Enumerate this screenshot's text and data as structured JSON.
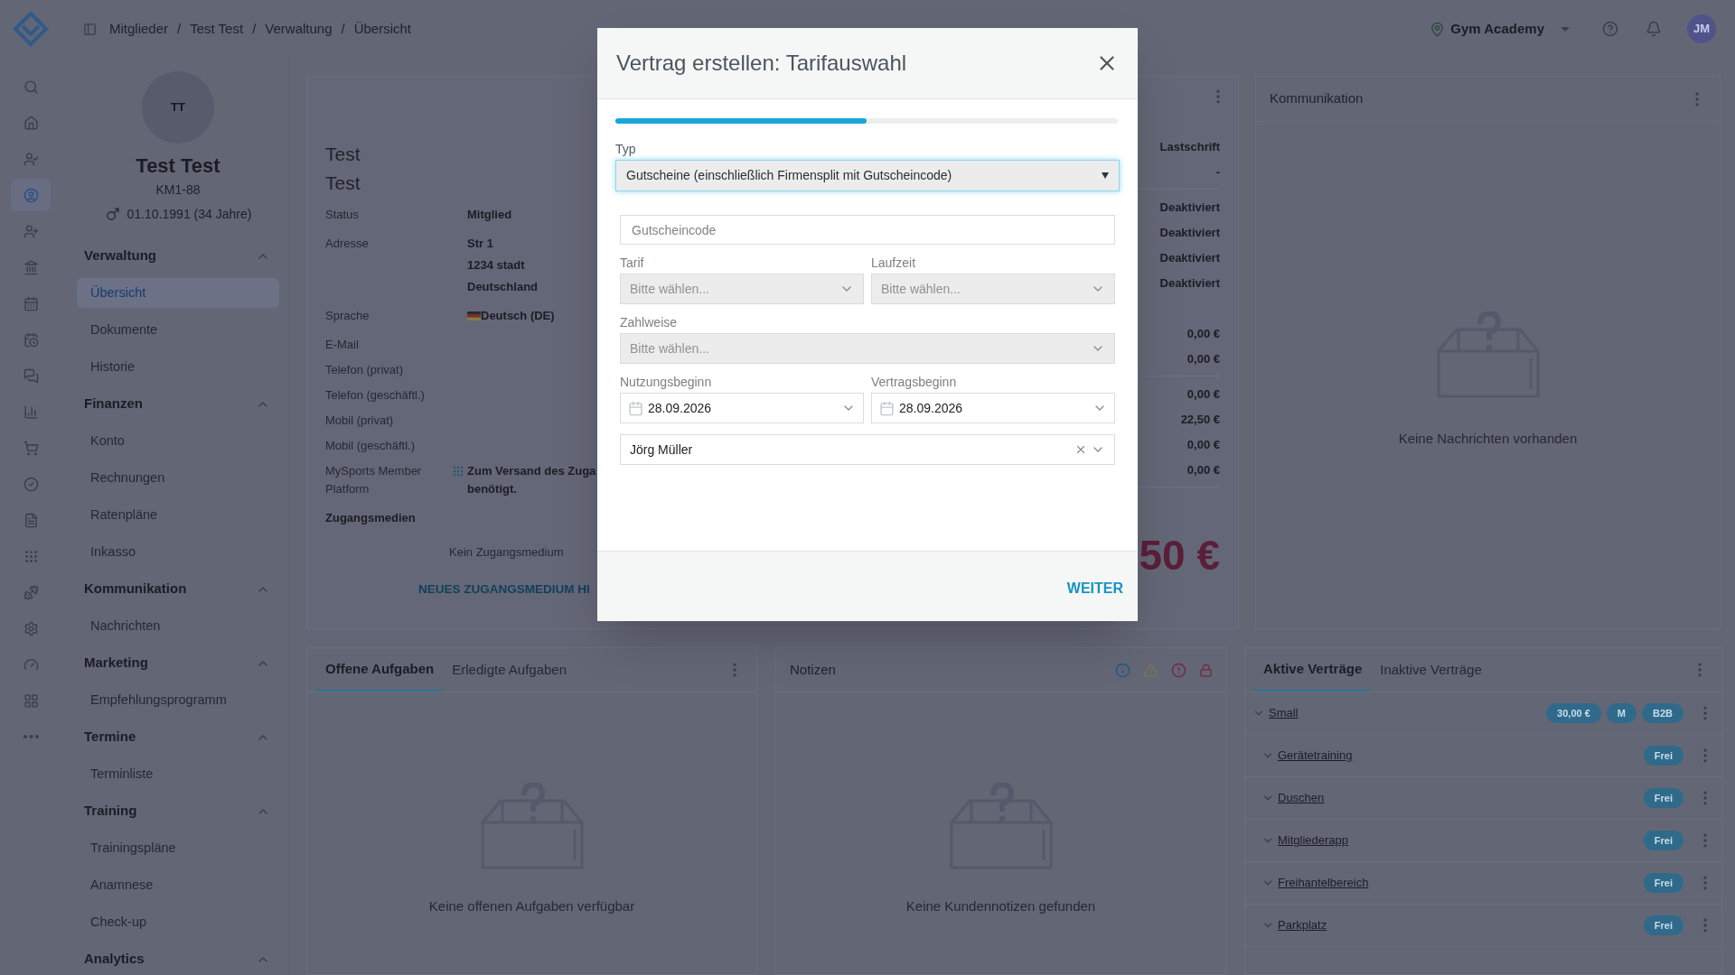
{
  "topbar": {
    "breadcrumb": [
      "Mitglieder",
      "Test Test",
      "Verwaltung",
      "Übersicht"
    ],
    "separator": "/",
    "location": "Gym Academy",
    "avatar": "JM"
  },
  "rail": [
    {
      "selected": false
    },
    {
      "selected": false
    },
    {
      "selected": false
    },
    {
      "selected": true
    },
    {
      "selected": false
    },
    {
      "selected": false
    },
    {
      "selected": false
    },
    {
      "selected": false
    },
    {
      "selected": false
    },
    {
      "selected": false
    },
    {
      "selected": false
    },
    {
      "selected": false
    },
    {
      "selected": false
    },
    {
      "selected": false
    },
    {
      "selected": false
    },
    {
      "selected": false
    },
    {
      "selected": false
    },
    {
      "selected": false
    }
  ],
  "profile": {
    "initials": "TT",
    "name": "Test Test",
    "number": "KM1-88",
    "birthdate": "01.10.1991 (34 Jahre)"
  },
  "nav": [
    {
      "title": "Verwaltung",
      "expanded": true,
      "items": [
        {
          "label": "Übersicht",
          "selected": true
        },
        {
          "label": "Dokumente",
          "selected": false
        },
        {
          "label": "Historie",
          "selected": false
        }
      ]
    },
    {
      "title": "Finanzen",
      "expanded": true,
      "items": [
        {
          "label": "Konto",
          "selected": false
        },
        {
          "label": "Rechnungen",
          "selected": false
        },
        {
          "label": "Ratenpläne",
          "selected": false
        },
        {
          "label": "Inkasso",
          "selected": false
        }
      ]
    },
    {
      "title": "Kommunikation",
      "expanded": true,
      "items": [
        {
          "label": "Nachrichten",
          "selected": false
        }
      ]
    },
    {
      "title": "Marketing",
      "expanded": true,
      "items": [
        {
          "label": "Empfehlungsprogramm",
          "selected": false
        }
      ]
    },
    {
      "title": "Termine",
      "expanded": true,
      "items": [
        {
          "label": "Terminliste",
          "selected": false
        }
      ]
    },
    {
      "title": "Training",
      "expanded": true,
      "items": [
        {
          "label": "Trainingspläne",
          "selected": false
        },
        {
          "label": "Anamnese",
          "selected": false
        },
        {
          "label": "Check-up",
          "selected": false
        }
      ]
    },
    {
      "title": "Analytics",
      "expanded": true
    }
  ],
  "member_card": {
    "names": [
      "Test",
      "Test"
    ],
    "fields": [
      {
        "label": "Status",
        "kind": "text",
        "values": [
          "Mitglied"
        ]
      },
      {
        "label": "Adresse",
        "kind": "text",
        "values": [
          "Str 1",
          "1234 stadt",
          "Deutschland"
        ]
      },
      {
        "label": "Sprache",
        "kind": "language",
        "values": [
          "Deutsch (DE)"
        ]
      },
      {
        "label": "E-Mail"
      },
      {
        "label": "Telefon (privat)"
      },
      {
        "label": "Telefon (geschäftl.)"
      },
      {
        "label": "Mobil (privat)"
      },
      {
        "label": "Mobil (geschäftl.)"
      },
      {
        "label": "MySports Member Platform",
        "kind": "platform",
        "values": [
          "Zum Versand des Zuga",
          "benötigt."
        ]
      }
    ],
    "access_title": "Zugangsmedien",
    "access_empty": "Kein Zugangsmedium",
    "access_add": "NEUES ZUGANGSMEDIUM HI",
    "value_groups": [
      {
        "divided": true,
        "values": [
          "Lastschrift",
          "-"
        ]
      },
      {
        "divided": false,
        "values": [
          "Deaktiviert",
          "Deaktiviert",
          "Deaktiviert",
          "Deaktiviert"
        ]
      },
      {
        "divided": true,
        "values": [
          "0,00 €",
          "0,00 €"
        ]
      },
      {
        "divided": true,
        "values": [
          "0,00 €",
          "22,50 €",
          "0,00 €",
          "0,00 €"
        ]
      }
    ],
    "total": "50 €"
  },
  "communication": {
    "title": "Kommunikation",
    "empty": "Keine Nachrichten vorhanden"
  },
  "tasks": {
    "tabs": [
      {
        "label": "Offene Aufgaben",
        "selected": true
      },
      {
        "label": "Erledigte Aufgaben",
        "selected": false
      }
    ],
    "empty": "Keine offenen Aufgaben verfügbar"
  },
  "notes": {
    "title": "Notizen",
    "empty": "Keine Kundennotizen gefunden"
  },
  "contracts": {
    "tabs": [
      {
        "label": "Aktive Verträge",
        "selected": true
      },
      {
        "label": "Inaktive Verträge",
        "selected": false
      }
    ],
    "rows": [
      {
        "name": "Small",
        "badges": [
          "30,00 €",
          "M",
          "B2B"
        ],
        "children": [
          {
            "name": "Gerätetraining",
            "badges": [
              "Frei"
            ]
          },
          {
            "name": "Duschen",
            "badges": [
              "Frei"
            ]
          },
          {
            "name": "Mitgliederapp",
            "badges": [
              "Frei"
            ]
          },
          {
            "name": "Freihantelbereich",
            "badges": [
              "Frei"
            ]
          },
          {
            "name": "Parkplatz",
            "badges": [
              "Frei"
            ]
          }
        ]
      }
    ]
  },
  "modal": {
    "title": "Vertrag erstellen: Tarifauswahl",
    "progress": {
      "level": 0.5
    },
    "type": {
      "label": "Typ",
      "value": "Gutscheine (einschließlich Firmensplit mit Gutscheincode)",
      "focused": true
    },
    "voucher": {
      "placeholder": "Gutscheincode"
    },
    "tariff": {
      "label": "Tarif",
      "placeholder": "Bitte wählen...",
      "disabled": true
    },
    "duration": {
      "label": "Laufzeit",
      "placeholder": "Bitte wählen...",
      "disabled": true
    },
    "payment": {
      "label": "Zahlweise",
      "placeholder": "Bitte wählen...",
      "disabled": true
    },
    "usage_start": {
      "label": "Nutzungsbeginn",
      "value": "28.09.2026"
    },
    "contract_start": {
      "label": "Vertragsbeginn",
      "value": "28.09.2026"
    },
    "person": {
      "value": "Jörg Müller"
    },
    "next": "WEITER"
  }
}
